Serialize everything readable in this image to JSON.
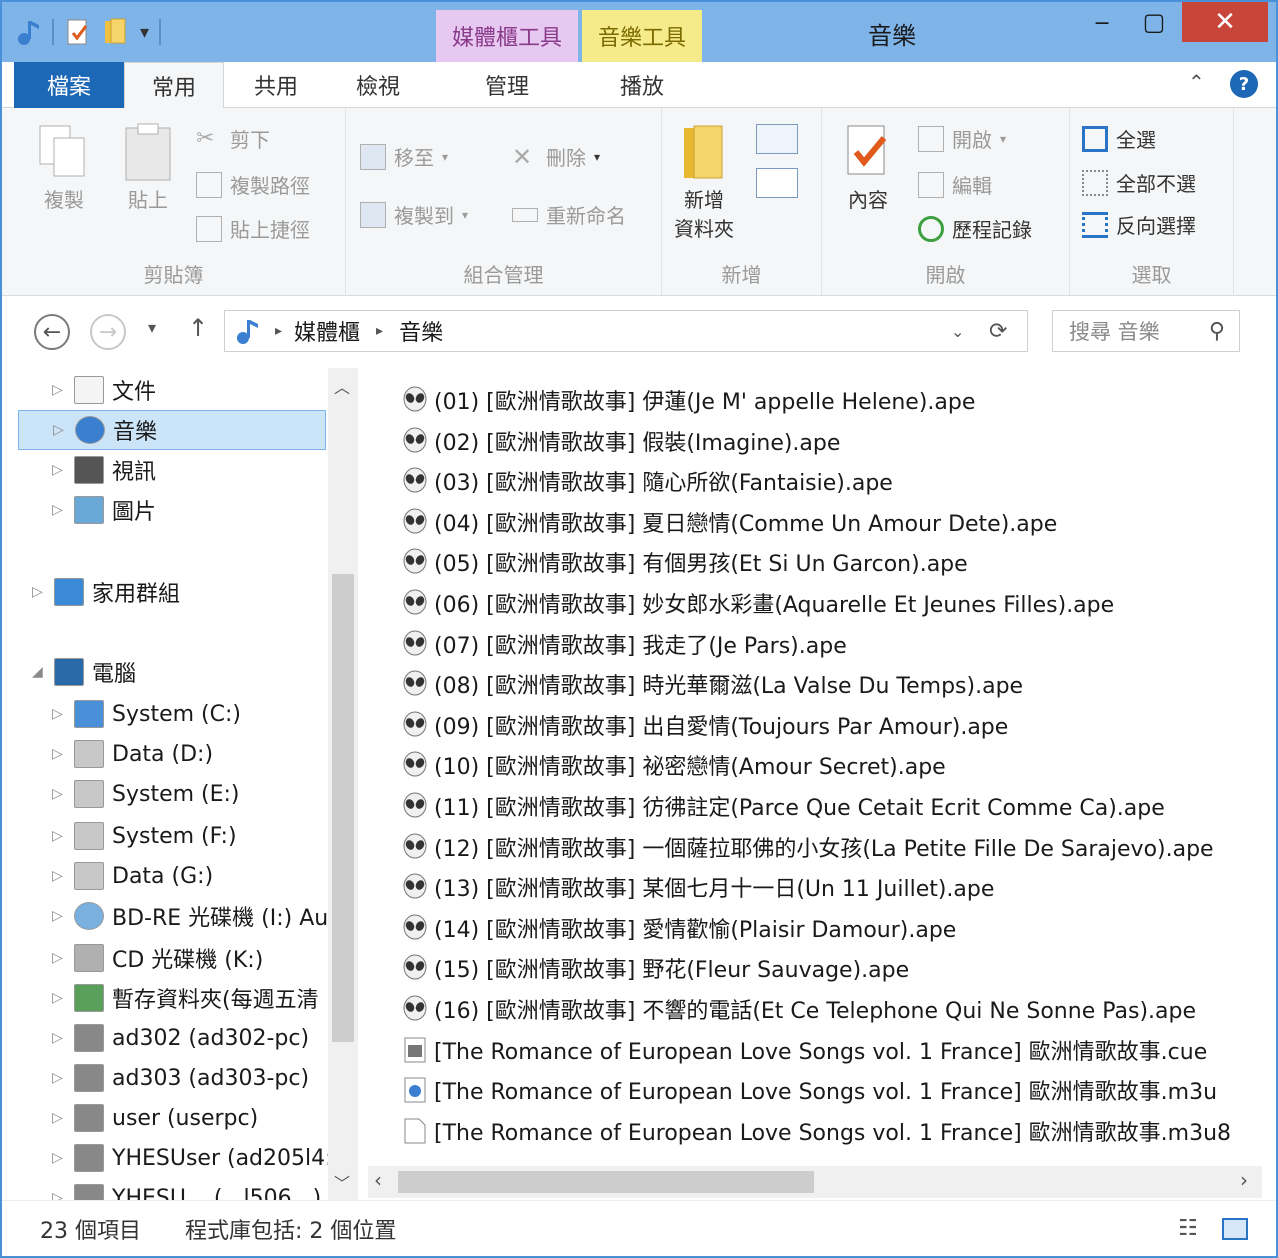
{
  "window": {
    "title": "音樂",
    "context_tabs": [
      "媒體櫃工具",
      "音樂工具"
    ],
    "minimize": "‒",
    "maximize": "▢",
    "close": "✕"
  },
  "ribbon_tabs": [
    {
      "label": "檔案"
    },
    {
      "label": "常用"
    },
    {
      "label": "共用"
    },
    {
      "label": "檢視"
    },
    {
      "label": "管理"
    },
    {
      "label": "播放"
    }
  ],
  "ribbon": {
    "clipboard": {
      "label": "剪貼簿",
      "copy": "複製",
      "paste": "貼上",
      "cut": "剪下",
      "copy_path": "複製路徑",
      "paste_shortcut": "貼上捷徑"
    },
    "organize": {
      "label": "組合管理",
      "move_to": "移至",
      "delete": "刪除",
      "copy_to": "複製到",
      "rename": "重新命名"
    },
    "new": {
      "label": "新增",
      "new_folder": "新增\n資料夾"
    },
    "open": {
      "label": "開啟",
      "properties": "內容",
      "open": "開啟",
      "edit": "編輯",
      "history": "歷程記錄"
    },
    "select": {
      "label": "選取",
      "select_all": "全選",
      "select_none": "全部不選",
      "invert": "反向選擇"
    }
  },
  "address": {
    "crumbs": [
      "媒體櫃",
      "音樂"
    ],
    "search_placeholder": "搜尋 音樂"
  },
  "nav": {
    "items": [
      {
        "label": "文件",
        "icon": "document-icon"
      },
      {
        "label": "音樂",
        "icon": "music-icon",
        "selected": true
      },
      {
        "label": "視訊",
        "icon": "video-icon"
      },
      {
        "label": "圖片",
        "icon": "picture-icon"
      },
      {
        "label": "家用群組",
        "icon": "homegroup-icon"
      },
      {
        "label": "電腦",
        "icon": "computer-icon"
      },
      {
        "label": "System (C:)",
        "icon": "system-drive-icon"
      },
      {
        "label": "Data (D:)",
        "icon": "drive-icon"
      },
      {
        "label": "System (E:)",
        "icon": "drive-icon"
      },
      {
        "label": "System (F:)",
        "icon": "drive-icon"
      },
      {
        "label": "Data (G:)",
        "icon": "drive-icon"
      },
      {
        "label": "BD-RE 光碟機 (I:) Au",
        "icon": "disc-icon"
      },
      {
        "label": "CD 光碟機 (K:)",
        "icon": "cd-drive-icon"
      },
      {
        "label": "暫存資料夾(每週五清",
        "icon": "network-drive-icon"
      },
      {
        "label": "ad302 (ad302-pc)",
        "icon": "network-pc-icon"
      },
      {
        "label": "ad303 (ad303-pc)",
        "icon": "network-pc-icon"
      },
      {
        "label": "user (userpc)",
        "icon": "network-pc-icon"
      },
      {
        "label": "YHESUser (ad205l4:",
        "icon": "network-pc-icon"
      },
      {
        "label": "YHESU... (...l506...)",
        "icon": "network-pc-icon"
      }
    ]
  },
  "files": [
    {
      "name": "(01) [歐洲情歌故事] 伊蓮(Je M' appelle Helene).ape",
      "type": "ape"
    },
    {
      "name": "(02) [歐洲情歌故事] 假裝(Imagine).ape",
      "type": "ape"
    },
    {
      "name": "(03) [歐洲情歌故事] 隨心所欲(Fantaisie).ape",
      "type": "ape"
    },
    {
      "name": "(04) [歐洲情歌故事] 夏日戀情(Comme Un Amour Dete).ape",
      "type": "ape"
    },
    {
      "name": "(05) [歐洲情歌故事] 有個男孩(Et Si Un Garcon).ape",
      "type": "ape"
    },
    {
      "name": "(06) [歐洲情歌故事] 妙女郎水彩畫(Aquarelle Et Jeunes Filles).ape",
      "type": "ape"
    },
    {
      "name": "(07) [歐洲情歌故事] 我走了(Je Pars).ape",
      "type": "ape"
    },
    {
      "name": "(08) [歐洲情歌故事] 時光華爾滋(La Valse Du Temps).ape",
      "type": "ape"
    },
    {
      "name": "(09) [歐洲情歌故事] 出自愛情(Toujours Par Amour).ape",
      "type": "ape"
    },
    {
      "name": "(10) [歐洲情歌故事] 祕密戀情(Amour Secret).ape",
      "type": "ape"
    },
    {
      "name": "(11) [歐洲情歌故事] 彷彿註定(Parce Que Cetait Ecrit Comme Ca).ape",
      "type": "ape"
    },
    {
      "name": "(12) [歐洲情歌故事] 一個薩拉耶佛的小女孩(La Petite Fille De Sarajevo).ape",
      "type": "ape"
    },
    {
      "name": "(13) [歐洲情歌故事] 某個七月十一日(Un 11 Juillet).ape",
      "type": "ape"
    },
    {
      "name": "(14) [歐洲情歌故事] 愛情歡愉(Plaisir Damour).ape",
      "type": "ape"
    },
    {
      "name": "(15) [歐洲情歌故事] 野花(Fleur Sauvage).ape",
      "type": "ape"
    },
    {
      "name": "(16) [歐洲情歌故事] 不響的電話(Et Ce Telephone Qui Ne Sonne Pas).ape",
      "type": "ape"
    },
    {
      "name": "[The Romance of European Love Songs vol. 1 France] 歐洲情歌故事.cue",
      "type": "cue"
    },
    {
      "name": "[The Romance of European Love Songs vol. 1 France] 歐洲情歌故事.m3u",
      "type": "m3u"
    },
    {
      "name": "[The Romance of European Love Songs vol. 1 France] 歐洲情歌故事.m3u8",
      "type": "m3u8"
    }
  ],
  "status": {
    "count": "23 個項目",
    "library": "程式庫包括: 2 個位置"
  }
}
